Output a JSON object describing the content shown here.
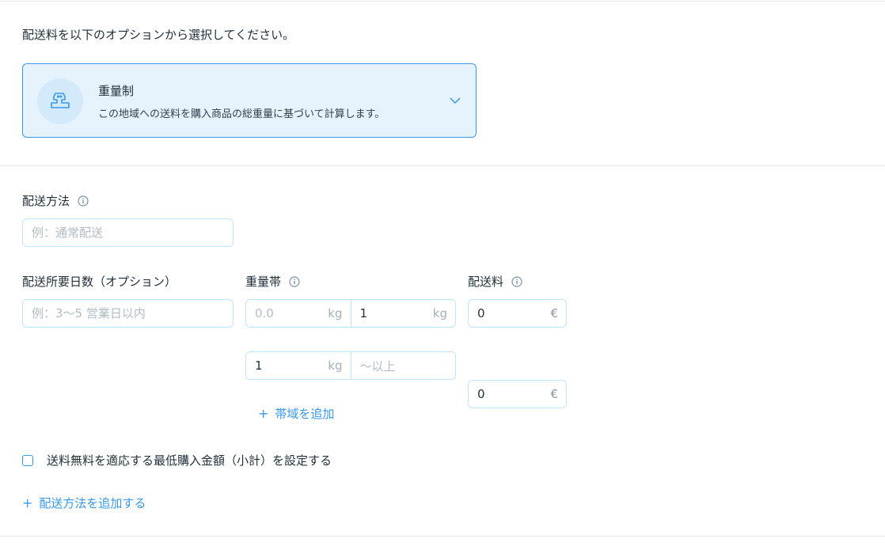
{
  "intro_text": "配送料を以下のオプションから選択してください。",
  "option": {
    "title": "重量制",
    "description": "この地域への送料を購入商品の総重量に基づいて計算します。",
    "icon": "scale-icon"
  },
  "shipping_method": {
    "label": "配送方法",
    "placeholder": "例：通常配送"
  },
  "delivery_time": {
    "label": "配送所要日数（オプション）",
    "placeholder": "例：3〜5 営業日以内"
  },
  "weight_range": {
    "label": "重量帯",
    "unit": "kg",
    "rows": [
      {
        "from": "",
        "from_placeholder": "0.0",
        "to": "1",
        "to_placeholder": ""
      },
      {
        "from": "1",
        "from_placeholder": "",
        "to": "",
        "to_placeholder": "〜以上"
      }
    ]
  },
  "shipping_fee": {
    "label": "配送料",
    "currency": "€",
    "rows": [
      {
        "value": "0"
      },
      {
        "value": "0"
      }
    ]
  },
  "add_range_label": "帯域を追加",
  "free_shipping_checkbox_label": "送料無料を適応する最低購入金額（小計）を設定する",
  "free_shipping_checked": false,
  "add_method_label": "配送方法を追加する",
  "colors": {
    "accent": "#3899ec",
    "card_bg": "#e7f3fc",
    "text": "#20303c",
    "placeholder": "#b0bcc6",
    "border": "#c1e4fe"
  }
}
